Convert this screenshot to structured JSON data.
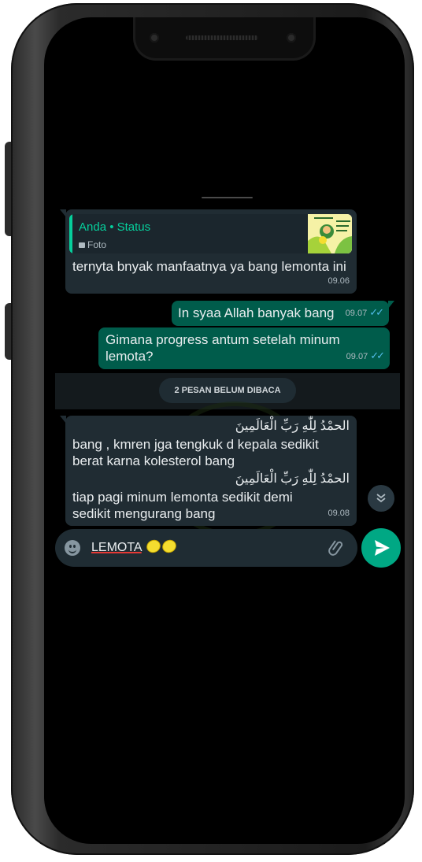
{
  "reply_quote": {
    "author": "Anda • Status",
    "type_label": "Foto",
    "text": "ternyta bnyak manfaatnya ya bang lemonta ini",
    "time": "09.06"
  },
  "messages_out": [
    {
      "text": "In syaa Allah banyak bang",
      "time": "09.07"
    },
    {
      "text": "Gimana progress antum setelah minum lemota?",
      "time": "09.07"
    }
  ],
  "unread_banner": "2 PESAN BELUM DIBACA",
  "message_in": {
    "arabic_1": "الحمْدُ لِلّٰهِ رَبِّ الْعَالَمِينَ",
    "text_1": "bang , kmren jga tengkuk d kepala sedikit berat karna kolesterol bang",
    "arabic_2": "الحمْدُ لِلّٰهِ رَبِّ الْعَالَمِينَ",
    "text_2": "tiap pagi minum lemonta sedikit demi sedikit mengurang bang",
    "time": "09.08"
  },
  "composer": {
    "text": "LEMOTA",
    "emojis": [
      "lemon",
      "lemon"
    ]
  },
  "icons": {
    "emoji": "emoji-icon",
    "attach": "paperclip-icon",
    "send": "send-icon",
    "scroll_down": "double-chevron-down-icon",
    "read_receipt": "double-check-icon"
  },
  "colors": {
    "incoming_bubble": "#202c33",
    "outgoing_bubble": "#005c4b",
    "accent": "#00a884",
    "quote_author": "#06cf9c",
    "read_tick": "#53bdeb"
  }
}
